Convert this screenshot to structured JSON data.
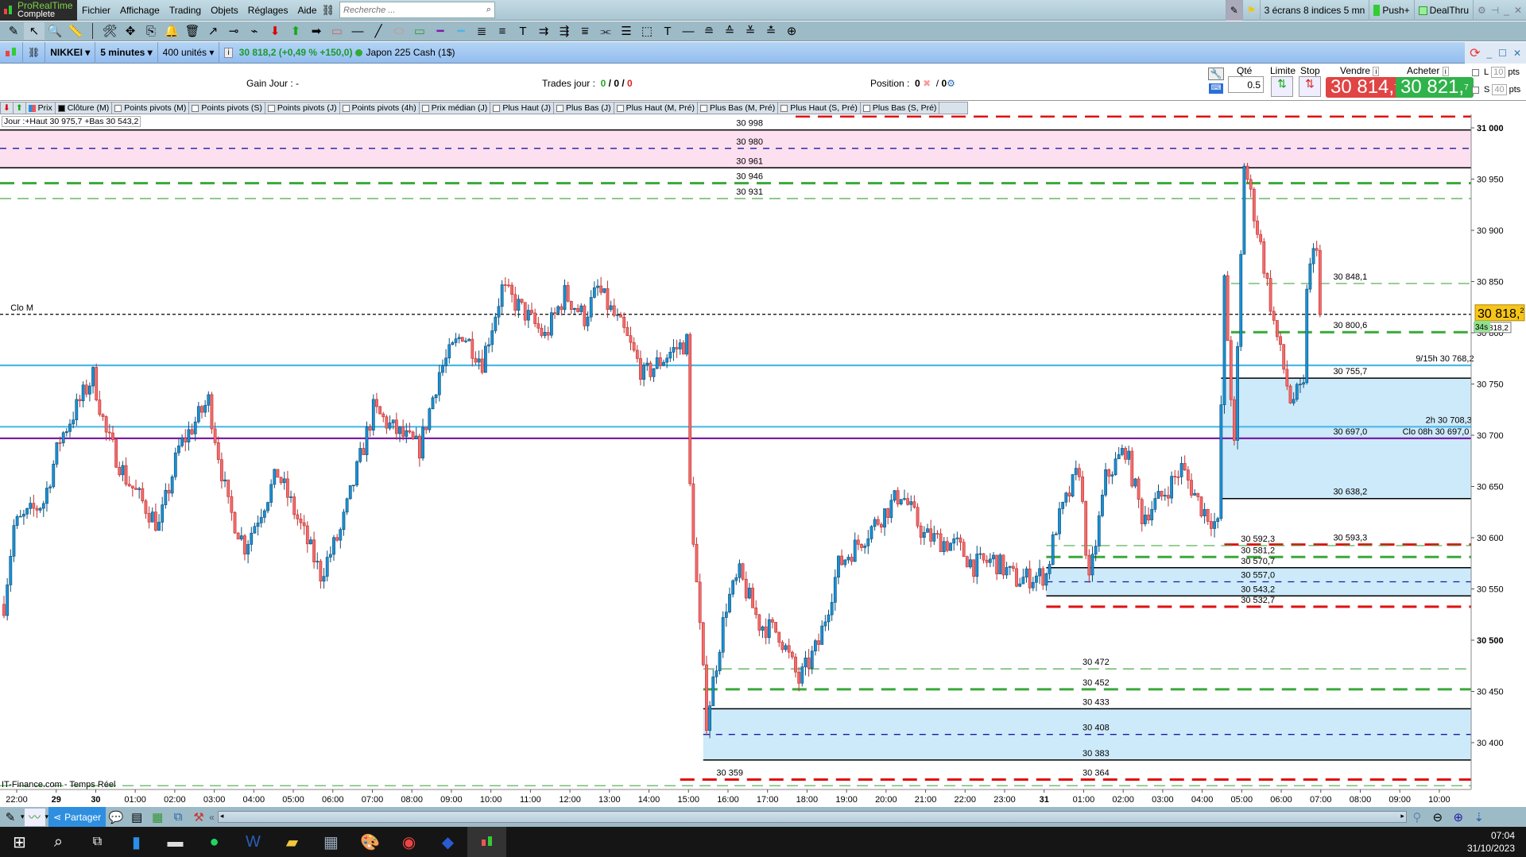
{
  "app": {
    "name": "ProRealTime",
    "edition": "Complete"
  },
  "menu": [
    "Fichier",
    "Affichage",
    "Trading",
    "Objets",
    "Réglages",
    "Aide"
  ],
  "search": {
    "placeholder": "Recherche ..."
  },
  "topright": {
    "layout": "3 écrans 8 indices 5 mn",
    "push": "Push+",
    "dealthru": "DealThru"
  },
  "toolbar_icons": [
    {
      "name": "pencil-icon",
      "g": "✎"
    },
    {
      "name": "pointer-icon",
      "g": "↖"
    },
    {
      "name": "zoom-icon",
      "g": "🔍"
    },
    {
      "name": "ruler-icon",
      "g": "📏"
    },
    {
      "name": "tools-icon",
      "g": "🛠"
    },
    {
      "name": "move-icon",
      "g": "✥"
    },
    {
      "name": "copy-icon",
      "g": "⎘"
    },
    {
      "name": "alert-bell-icon",
      "g": "🔔"
    },
    {
      "name": "trash-icon",
      "g": "🗑"
    },
    {
      "name": "arrow-line-icon",
      "g": "↗"
    },
    {
      "name": "segment-icon",
      "g": "⊸"
    },
    {
      "name": "polyline-icon",
      "g": "⌁"
    },
    {
      "name": "sell-arrow-icon",
      "g": "⬇",
      "c": "#d00"
    },
    {
      "name": "buy-arrow-icon",
      "g": "⬆",
      "c": "#1a1"
    },
    {
      "name": "right-arrow-icon",
      "g": "➡"
    },
    {
      "name": "horizontal-zone-icon",
      "g": "▭",
      "c": "#c66"
    },
    {
      "name": "horizontal-line-icon",
      "g": "—"
    },
    {
      "name": "trendline-icon",
      "g": "╱"
    },
    {
      "name": "ellipse-icon",
      "g": "⬭",
      "c": "#d87"
    },
    {
      "name": "rectangle-icon",
      "g": "▭",
      "c": "#393"
    },
    {
      "name": "purple-line-icon",
      "g": "━",
      "c": "#7a1fa8"
    },
    {
      "name": "blue-line-icon",
      "g": "━",
      "c": "#4ab8e8"
    },
    {
      "name": "fibonacci-icon",
      "g": "≣"
    },
    {
      "name": "fib-fan-icon",
      "g": "≡"
    },
    {
      "name": "text-icon",
      "g": "T"
    },
    {
      "name": "channel-icon",
      "g": "⇉"
    },
    {
      "name": "channel2-icon",
      "g": "⇶"
    },
    {
      "name": "gann-icon",
      "g": "⩸"
    },
    {
      "name": "pitchfork-icon",
      "g": "⫘"
    },
    {
      "name": "levels-icon",
      "g": "☰"
    },
    {
      "name": "measure-icon",
      "g": "⬚"
    },
    {
      "name": "text-box-icon",
      "g": "T"
    },
    {
      "name": "hline2-icon",
      "g": "—"
    },
    {
      "name": "levels2-icon",
      "g": "≘"
    },
    {
      "name": "levels3-icon",
      "g": "≙"
    },
    {
      "name": "levels4-icon",
      "g": "≚"
    },
    {
      "name": "levels5-icon",
      "g": "≛"
    },
    {
      "name": "web-icon",
      "g": "⊕"
    }
  ],
  "instrument": {
    "ticker": "NIKKEI",
    "interval": "5 minutes",
    "units": "400 unités",
    "quote": "30 818,2 (+0,49 % +150,0)",
    "name": "Japon 225 Cash (1$)"
  },
  "order": {
    "gain_label": "Gain Jour :",
    "gain_value": "-",
    "trades_label": "Trades jour :",
    "trades_win": "0",
    "trades_flat": "0",
    "trades_loss": "0",
    "sep": "/",
    "position_label": "Position :",
    "position_value": "0",
    "position_value2": "0",
    "qty_label": "Qté",
    "qty": "0.5",
    "limit_label": "Limite",
    "stop_label": "Stop",
    "sell_label": "Vendre",
    "sell_price": "30 814,",
    "sell_frac": "7",
    "buy_label": "Acheter",
    "buy_price": "30 821,",
    "buy_frac": "7",
    "long_label": "L",
    "long_pts": "10",
    "short_label": "S",
    "short_pts": "40",
    "pts": "pts"
  },
  "indicators": [
    "Prix",
    "Clôture (M)",
    "Points pivots (M)",
    "Points pivots (S)",
    "Points pivots (J)",
    "Points pivots (4h)",
    "Prix médian (J)",
    "Plus Haut (J)",
    "Plus Bas (J)",
    "Plus Haut (M, Pré)",
    "Plus Bas (M, Pré)",
    "Plus Haut (S, Pré)",
    "Plus Bas (S, Pré)"
  ],
  "day_info": "Jour :+Haut 30 975,7 +Bas 30 543,2",
  "source": "IT-Finance.com - Temps Réel",
  "colors": {
    "up": "#1b8fd2",
    "down": "#f26b6b",
    "pink_zone": "#fde0ef",
    "blue_zone": "#cdeafa",
    "purple": "#7a1fa8",
    "lightblue": "#4ab8e8"
  },
  "chart_data": {
    "type": "candlestick",
    "instrument": "NIKKEI",
    "candles": 400,
    "ylim": [
      30340,
      31030
    ],
    "price_ticks": [
      "31 000",
      "30 950",
      "30 900",
      "30 850",
      "30 800",
      "30 750",
      "30 700",
      "30 650",
      "30 600",
      "30 550",
      "30 500",
      "30 450",
      "30 400"
    ],
    "price_tick_values": [
      31000,
      30950,
      30900,
      30850,
      30800,
      30750,
      30700,
      30650,
      30600,
      30550,
      30500,
      30450,
      30400
    ],
    "time_labels": [
      "22:00",
      "29",
      "30",
      "01:00",
      "02:00",
      "03:00",
      "04:00",
      "05:00",
      "06:00",
      "07:00",
      "08:00",
      "09:00",
      "10:00",
      "11:00",
      "12:00",
      "13:00",
      "14:00",
      "15:00",
      "16:00",
      "17:00",
      "18:00",
      "19:00",
      "20:00",
      "21:00",
      "22:00",
      "23:00",
      "31",
      "01:00",
      "02:00",
      "03:00",
      "04:00",
      "05:00",
      "06:00",
      "07:00",
      "08:00",
      "09:00",
      "10:00"
    ],
    "close_path": [
      [
        0,
        30535
      ],
      [
        3,
        30611
      ],
      [
        12,
        30635
      ],
      [
        17,
        30696
      ],
      [
        27,
        30758
      ],
      [
        31,
        30701
      ],
      [
        37,
        30658
      ],
      [
        47,
        30611
      ],
      [
        53,
        30687
      ],
      [
        62,
        30734
      ],
      [
        68,
        30630
      ],
      [
        73,
        30592
      ],
      [
        83,
        30663
      ],
      [
        90,
        30611
      ],
      [
        96,
        30564
      ],
      [
        102,
        30606
      ],
      [
        112,
        30725
      ],
      [
        118,
        30706
      ],
      [
        126,
        30687
      ],
      [
        132,
        30762
      ],
      [
        139,
        30800
      ],
      [
        145,
        30772
      ],
      [
        151,
        30843
      ],
      [
        158,
        30819
      ],
      [
        164,
        30796
      ],
      [
        170,
        30838
      ],
      [
        176,
        30815
      ],
      [
        180,
        30843
      ],
      [
        188,
        30800
      ],
      [
        194,
        30758
      ],
      [
        202,
        30781
      ],
      [
        207,
        30791
      ],
      [
        208,
        30649
      ],
      [
        210,
        30554
      ],
      [
        213,
        30422
      ],
      [
        219,
        30535
      ],
      [
        223,
        30564
      ],
      [
        229,
        30516
      ],
      [
        235,
        30507
      ],
      [
        241,
        30460
      ],
      [
        247,
        30497
      ],
      [
        253,
        30573
      ],
      [
        261,
        30602
      ],
      [
        272,
        30644
      ],
      [
        279,
        30602
      ],
      [
        289,
        30592
      ],
      [
        294,
        30573
      ],
      [
        300,
        30578
      ],
      [
        307,
        30559
      ],
      [
        316,
        30564
      ],
      [
        319,
        30611
      ],
      [
        326,
        30668
      ],
      [
        329,
        30554
      ],
      [
        334,
        30658
      ],
      [
        340,
        30687
      ],
      [
        345,
        30621
      ],
      [
        351,
        30640
      ],
      [
        357,
        30668
      ],
      [
        363,
        30630
      ],
      [
        368,
        30611
      ],
      [
        370,
        30848
      ],
      [
        373,
        30687
      ],
      [
        376,
        30966
      ],
      [
        381,
        30885
      ],
      [
        385,
        30810
      ],
      [
        390,
        30734
      ],
      [
        394,
        30744
      ],
      [
        395,
        30848
      ],
      [
        398,
        30890
      ],
      [
        399,
        30819
      ]
    ],
    "last_price": "30 818,",
    "last_price_frac": "2",
    "last_price_small": "30 818,2",
    "countdown": "34s",
    "zones": [
      {
        "from": 30998,
        "to": 30961,
        "start": 0,
        "color": "pink"
      },
      {
        "from": 30755.7,
        "to": 30638.2,
        "start": 369,
        "color": "blue"
      },
      {
        "from": 30570.7,
        "to": 30543.2,
        "start": 316,
        "color": "blue"
      },
      {
        "from": 30433,
        "to": 30383,
        "start": 212,
        "color": "blue"
      }
    ],
    "levels": [
      {
        "price": 31011,
        "style": "red-dash",
        "start": 240,
        "label": ""
      },
      {
        "price": 30998,
        "style": "black",
        "start": 0,
        "label": "30 998",
        "lx": 222
      },
      {
        "price": 30980,
        "style": "navy-dash",
        "start": 0,
        "label": "30 980",
        "lx": 222
      },
      {
        "price": 30961,
        "style": "black",
        "start": 0,
        "label": "30 961",
        "lx": 222
      },
      {
        "price": 30946,
        "style": "green-dash-thick",
        "start": 0,
        "label": "30 946",
        "lx": 222
      },
      {
        "price": 30931,
        "style": "green-dash",
        "start": 0,
        "label": "30 931",
        "lx": 222
      },
      {
        "price": 30848.1,
        "style": "green-dash",
        "start": 372,
        "label": "30 848,1",
        "lx": 403
      },
      {
        "price": 30818,
        "style": "black-dot",
        "start": 0,
        "label": "Clo M",
        "lx": 2
      },
      {
        "price": 30800.6,
        "style": "green-dash-thick",
        "start": 372,
        "label": "30 800,6",
        "lx": 403
      },
      {
        "price": 30768.2,
        "style": "lightblue",
        "start": 0,
        "label": "9/15h 30 768,2",
        "lx": 428
      },
      {
        "price": 30755.7,
        "style": "black",
        "start": 369,
        "label": "30 755,7",
        "lx": 403
      },
      {
        "price": 30708.3,
        "style": "lightblue",
        "start": 0,
        "label": "2h 30 708,3",
        "lx": 431
      },
      {
        "price": 30697.0,
        "style": "purple",
        "start": 0,
        "label": "30 697,0",
        "lx": 403
      },
      {
        "price": 30697.01,
        "style": "none",
        "start": 0,
        "label": "Clo 08h 30 697,0",
        "lx": 424
      },
      {
        "price": 30638.2,
        "style": "black",
        "start": 369,
        "label": "30 638,2",
        "lx": 403
      },
      {
        "price": 30593.3,
        "style": "red-dash-thick",
        "start": 370,
        "label": "30 593,3",
        "lx": 403
      },
      {
        "price": 30592.3,
        "style": "green-dash",
        "start": 316,
        "label": "30 592,3",
        "lx": 375
      },
      {
        "price": 30581.2,
        "style": "green-dash-thick",
        "start": 316,
        "label": "30 581,2",
        "lx": 375
      },
      {
        "price": 30570.7,
        "style": "black",
        "start": 316,
        "label": "30 570,7",
        "lx": 375
      },
      {
        "price": 30557.0,
        "style": "navy-dash",
        "start": 316,
        "label": "30 557,0",
        "lx": 375
      },
      {
        "price": 30543.2,
        "style": "black",
        "start": 316,
        "label": "30 543,2",
        "lx": 375
      },
      {
        "price": 30532.7,
        "style": "red-dash-thick",
        "start": 316,
        "label": "30 532,7",
        "lx": 375
      },
      {
        "price": 30472,
        "style": "green-dash",
        "start": 212,
        "label": "30 472",
        "lx": 327
      },
      {
        "price": 30452,
        "style": "green-dash-thick",
        "start": 212,
        "label": "30 452",
        "lx": 327
      },
      {
        "price": 30433,
        "style": "black",
        "start": 212,
        "label": "30 433",
        "lx": 327
      },
      {
        "price": 30408,
        "style": "navy-dash",
        "start": 212,
        "label": "30 408",
        "lx": 327
      },
      {
        "price": 30383,
        "style": "black",
        "start": 212,
        "label": "30 383",
        "lx": 327
      },
      {
        "price": 30364,
        "style": "red-dash-thick",
        "start": 205,
        "label": "30 364",
        "lx": 327
      },
      {
        "price": 30364.01,
        "style": "none",
        "start": 0,
        "label": "30 359",
        "lx": 216
      },
      {
        "price": 30358,
        "style": "green-dash",
        "start": 0,
        "label": ""
      }
    ]
  },
  "bottom": {
    "share": "Partager"
  },
  "clock": {
    "time": "07:04",
    "date": "31/10/2023"
  }
}
